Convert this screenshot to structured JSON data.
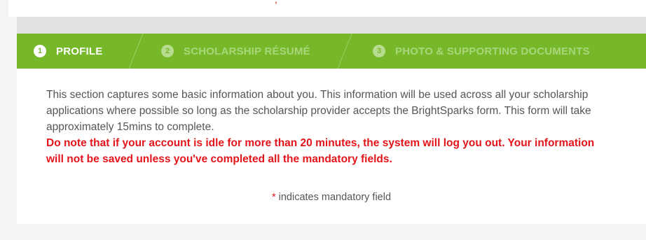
{
  "steps": [
    {
      "number": "1",
      "label": "PROFILE",
      "state": "active"
    },
    {
      "number": "2",
      "label": "SCHOLARSHIP RÉSUMÉ",
      "state": "inactive"
    },
    {
      "number": "3",
      "label": "PHOTO & SUPPORTING DOCUMENTS",
      "state": "inactive"
    }
  ],
  "intro": {
    "text": "This section captures some basic information about you. This information will be used across all your scholarship applications where possible so long as the scholarship provider accepts the BrightSparks form. This form will take approximately 15mins to complete."
  },
  "warning": {
    "text": "Do note that if your account is idle for more than 20 minutes, the system will log you out. Your information will not be saved unless you've completed all the mandatory fields."
  },
  "mandatory_note": {
    "asterisk": "*",
    "text": "indicates mandatory field"
  },
  "colors": {
    "step_bar_green": "#76b82a",
    "warning_red": "#e3141a",
    "body_text_grey": "#555555"
  }
}
